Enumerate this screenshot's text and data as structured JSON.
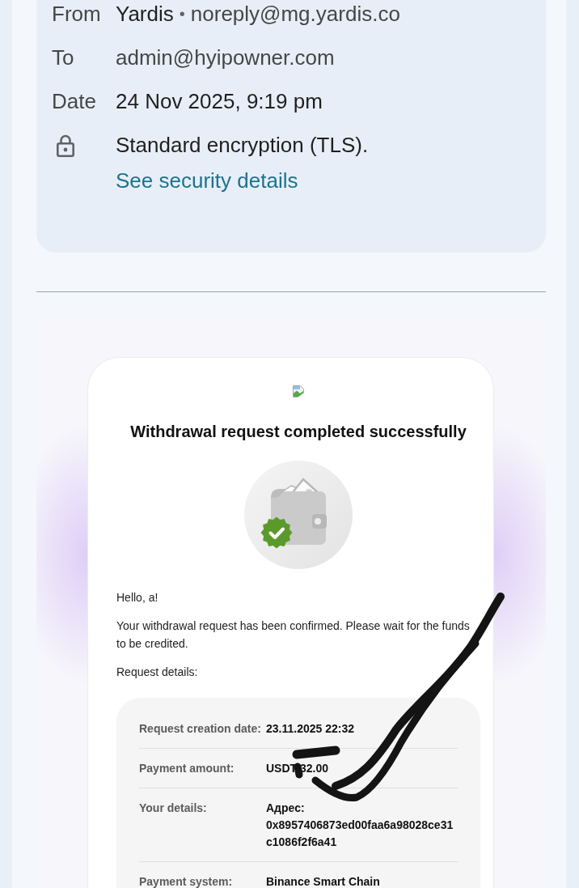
{
  "header": {
    "rows": [
      {
        "kind": "sender",
        "label": "From",
        "name": "Yardis",
        "separator": "•",
        "address": "noreply@mg.yardis.co"
      },
      {
        "kind": "address",
        "label": "To",
        "value": "admin@hyipowner.com"
      },
      {
        "kind": "text",
        "label": "Date",
        "value": "24 Nov 2025, 9:19 pm"
      },
      {
        "kind": "security",
        "value": "Standard encryption (TLS).",
        "link": "See security details"
      }
    ]
  },
  "message": {
    "title": "Withdrawal request completed successfully",
    "greeting": "Hello, a!",
    "body": "Your withdrawal request has been confirmed. Please wait for the funds to be credited.",
    "details_heading": "Request details:",
    "details": [
      {
        "label": "Request creation date:",
        "value": "23.11.2025 22:32"
      },
      {
        "label": "Payment amount:",
        "value": "USDT 32.00"
      },
      {
        "label": "Your details:",
        "value": "Адрес: 0x8957406873ed00faa6a98028ce31c1086f2f6a41"
      },
      {
        "label": "Payment system:",
        "value": "Binance Smart Chain"
      }
    ]
  }
}
